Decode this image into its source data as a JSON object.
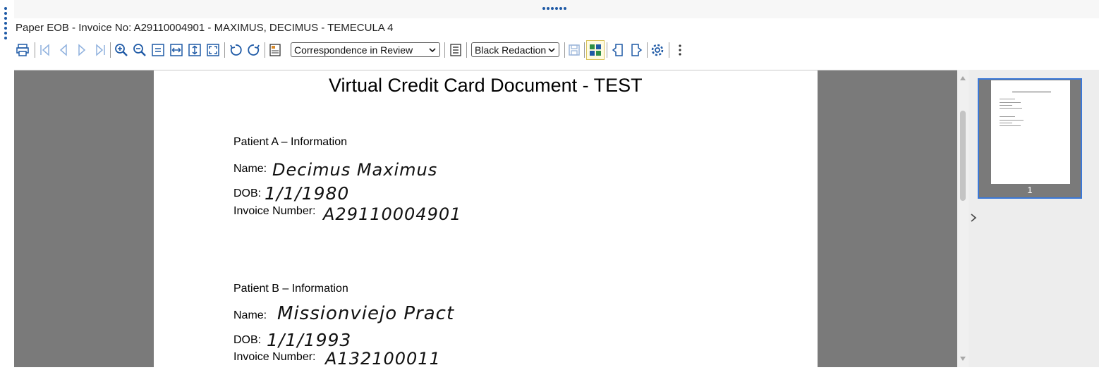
{
  "window": {
    "title": "Paper EOB - Invoice No: A29110004901 - MAXIMUS, DECIMUS - TEMECULA 4"
  },
  "toolbar": {
    "buttons": [
      {
        "name": "print-button",
        "icon": "printer-icon"
      },
      {
        "name": "first-page-button",
        "icon": "first-page-icon"
      },
      {
        "name": "previous-page-button",
        "icon": "previous-icon"
      },
      {
        "name": "next-page-button",
        "icon": "next-icon"
      },
      {
        "name": "last-page-button",
        "icon": "last-page-icon"
      },
      {
        "name": "zoom-in-button",
        "icon": "zoom-in-icon"
      },
      {
        "name": "zoom-out-button",
        "icon": "zoom-out-icon"
      },
      {
        "name": "fit-page-button",
        "icon": "fit-page-icon"
      },
      {
        "name": "fit-width-button",
        "icon": "fit-width-icon"
      },
      {
        "name": "fit-height-button",
        "icon": "fit-height-icon"
      },
      {
        "name": "full-screen-button",
        "icon": "expand-icon"
      },
      {
        "name": "rotate-left-button",
        "icon": "rotate-ccw-icon"
      },
      {
        "name": "rotate-right-button",
        "icon": "rotate-cw-icon"
      },
      {
        "name": "document-properties-button",
        "icon": "document-icon"
      },
      {
        "name": "annotations-button",
        "icon": "list-icon"
      },
      {
        "name": "save-button",
        "icon": "save-icon"
      },
      {
        "name": "thumbnails-toggle-button",
        "icon": "thumbnails-icon"
      },
      {
        "name": "page-before-button",
        "icon": "page-left-icon"
      },
      {
        "name": "page-after-button",
        "icon": "page-right-icon"
      },
      {
        "name": "settings-button",
        "icon": "gear-icon"
      },
      {
        "name": "more-options-button",
        "icon": "kebab-icon"
      }
    ],
    "status_select": {
      "value": "Correspondence in Review"
    },
    "redaction_select": {
      "value": "Black Redaction"
    }
  },
  "document": {
    "title": "Virtual Credit Card Document - TEST",
    "patient_a": {
      "heading": "Patient A – Information",
      "name_label": "Name:",
      "name_value": "Decimus Maximus",
      "dob_label": "DOB:",
      "dob_value": "1/1/1980",
      "invoice_label": "Invoice Number:",
      "invoice_value": "A29110004901"
    },
    "patient_b": {
      "heading": "Patient B – Information",
      "name_label": "Name:",
      "name_value": "Missionviejo Pract",
      "dob_label": "DOB:",
      "dob_value": "1/1/1993",
      "invoice_label": "Invoice Number:",
      "invoice_value": "A132100011"
    }
  },
  "thumbnails": {
    "pages": [
      {
        "number": "1",
        "selected": true
      }
    ]
  },
  "colors": {
    "icon_blue": "#1f5aa6",
    "viewer_gray": "#7a7a7a",
    "selection_blue": "#3a78d8"
  }
}
